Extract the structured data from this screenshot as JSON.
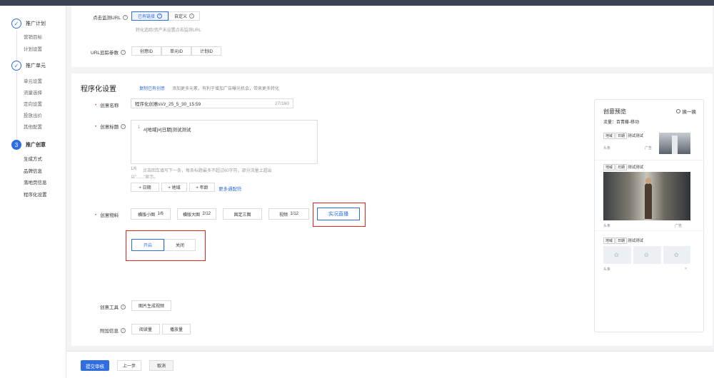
{
  "sidebar": {
    "step1": {
      "num": "✓",
      "label": "推广计划",
      "subs": [
        "营销目标",
        "计划设置"
      ]
    },
    "step2": {
      "num": "✓",
      "label": "推广单元",
      "subs": [
        "单元设置",
        "流量选择",
        "定向设置",
        "投放出价",
        "其他配置"
      ]
    },
    "step3": {
      "num": "3",
      "label": "推广创意",
      "subs": [
        "生成方式",
        "品牌信息",
        "落地页信息",
        "程序化设置"
      ]
    }
  },
  "monitor": {
    "label": "点击监测URL",
    "opt_existing": "已有链接",
    "opt_custom": "自定义",
    "hint": "转化追踪/资产未设置点击监测URL",
    "param_label": "URL追踪参数",
    "params": [
      "创意ID",
      "单元ID",
      "计划ID"
    ]
  },
  "programmatic": {
    "title": "程序化设置",
    "copy_link": "复制已有创意",
    "desc": "添加更多元素，有利于增加广告曝光机会，带来更多转化",
    "name_label": "创意名称",
    "name_value": "程序化创意sVz_25_5_30_15:59",
    "name_count": "27/160",
    "title_label": "创意标题",
    "title_line": "1",
    "title_value": "#[地域]#[日期]测试测试",
    "title_hint_count": "1/6",
    "title_hint": "点击回车填写下一条，每条标题最多不超过60字符，部分流量上超出",
    "title_hint2": "以\"......\"显示。",
    "insert_buttons": [
      "+ 日期",
      "+ 地域",
      "+ 年龄"
    ],
    "more_link": "更多通配符",
    "material_label": "创意物料",
    "materials": [
      {
        "name": "横版小图",
        "count": "1/6"
      },
      {
        "name": "横版大图",
        "count": "2/12"
      },
      {
        "name": "固定三图",
        "count": ""
      },
      {
        "name": "视频",
        "count": "1/12"
      }
    ],
    "live_button": "实况直播",
    "toggle_on": "开启",
    "toggle_off": "关闭",
    "tool_label": "创意工具",
    "tool_button": "图片生成视频",
    "extra_label": "附加信息",
    "extra_buttons": [
      "阅读量",
      "播放量"
    ]
  },
  "preview": {
    "title": "创意预览",
    "switch": "换一换",
    "flow": "流量：百青藤-移动",
    "tags": [
      "地域",
      "日期"
    ],
    "tag_text": "测试测试",
    "source": "头条",
    "ad": "广告",
    "close": "×"
  },
  "footer": {
    "submit": "提交审核",
    "prev": "上一步",
    "cancel": "取消"
  },
  "colors": {
    "primary": "#2f6de1",
    "highlight": "#e02424"
  }
}
